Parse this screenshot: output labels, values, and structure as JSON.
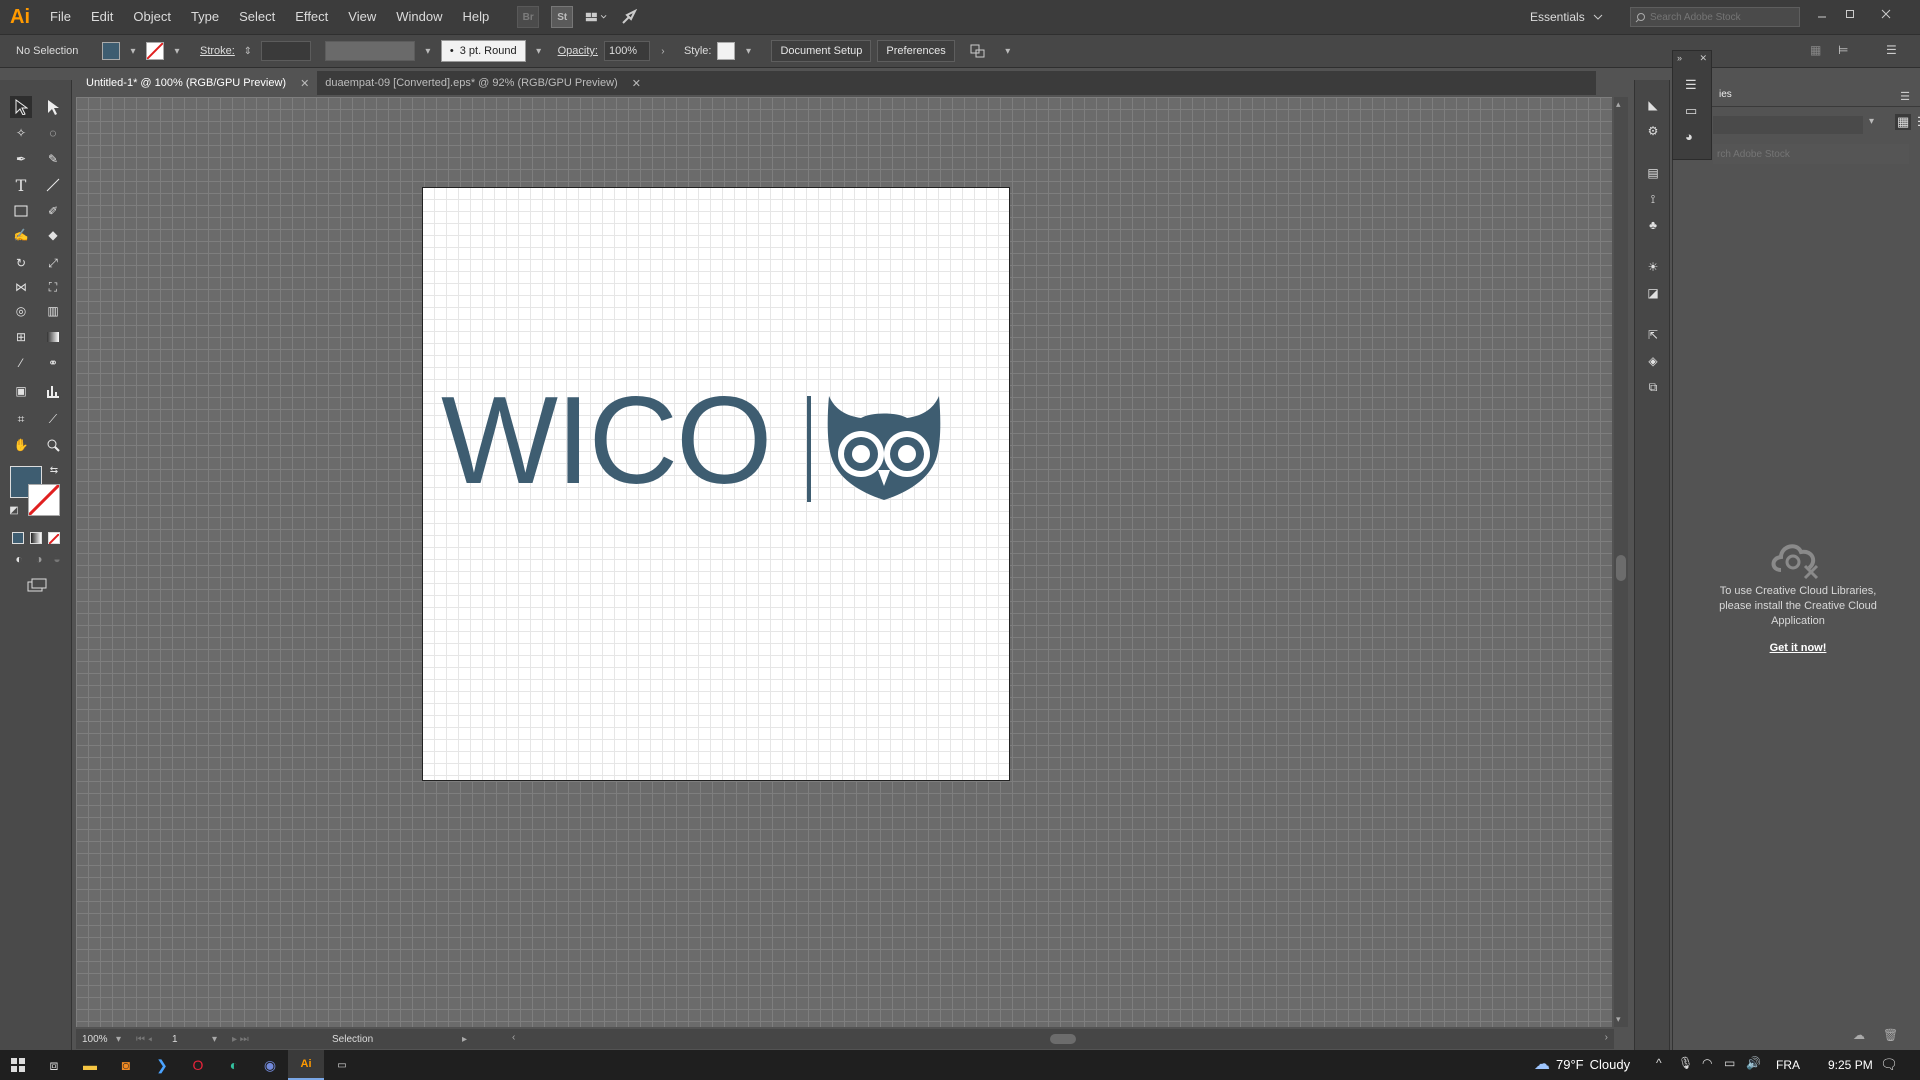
{
  "app": {
    "logo_text": "Ai",
    "menu": [
      "File",
      "Edit",
      "Object",
      "Type",
      "Select",
      "Effect",
      "View",
      "Window",
      "Help"
    ],
    "stock_badge": "St",
    "workspace": "Essentials",
    "search_placeholder": "Search Adobe Stock"
  },
  "controlbar": {
    "selection_status": "No Selection",
    "stroke_label": "Stroke:",
    "brush_value": "3 pt. Round",
    "opacity_label": "Opacity:",
    "opacity_value": "100%",
    "style_label": "Style:",
    "doc_setup": "Document Setup",
    "preferences": "Preferences"
  },
  "tabs": [
    {
      "label": "Untitled-1* @ 100% (RGB/GPU Preview)",
      "active": true
    },
    {
      "label": "duaempat-09 [Converted].eps* @ 92% (RGB/GPU Preview)",
      "active": false
    }
  ],
  "artwork": {
    "logo_text": "WICO",
    "color": "#3e5d71"
  },
  "libraries": {
    "partial_tab": "ies",
    "search_placeholder": "rch Adobe Stock",
    "message": "To use Creative Cloud Libraries, please install the Creative Cloud Application",
    "link": "Get it now!"
  },
  "status": {
    "zoom": "100%",
    "artboard_number": "1",
    "tool": "Selection"
  },
  "taskbar": {
    "temperature": "79°F",
    "weather": "Cloudy",
    "language": "FRA",
    "time": "9:25 PM"
  },
  "colors": {
    "fill": "#3e5d71",
    "accent_orange": "#ff9a00"
  }
}
